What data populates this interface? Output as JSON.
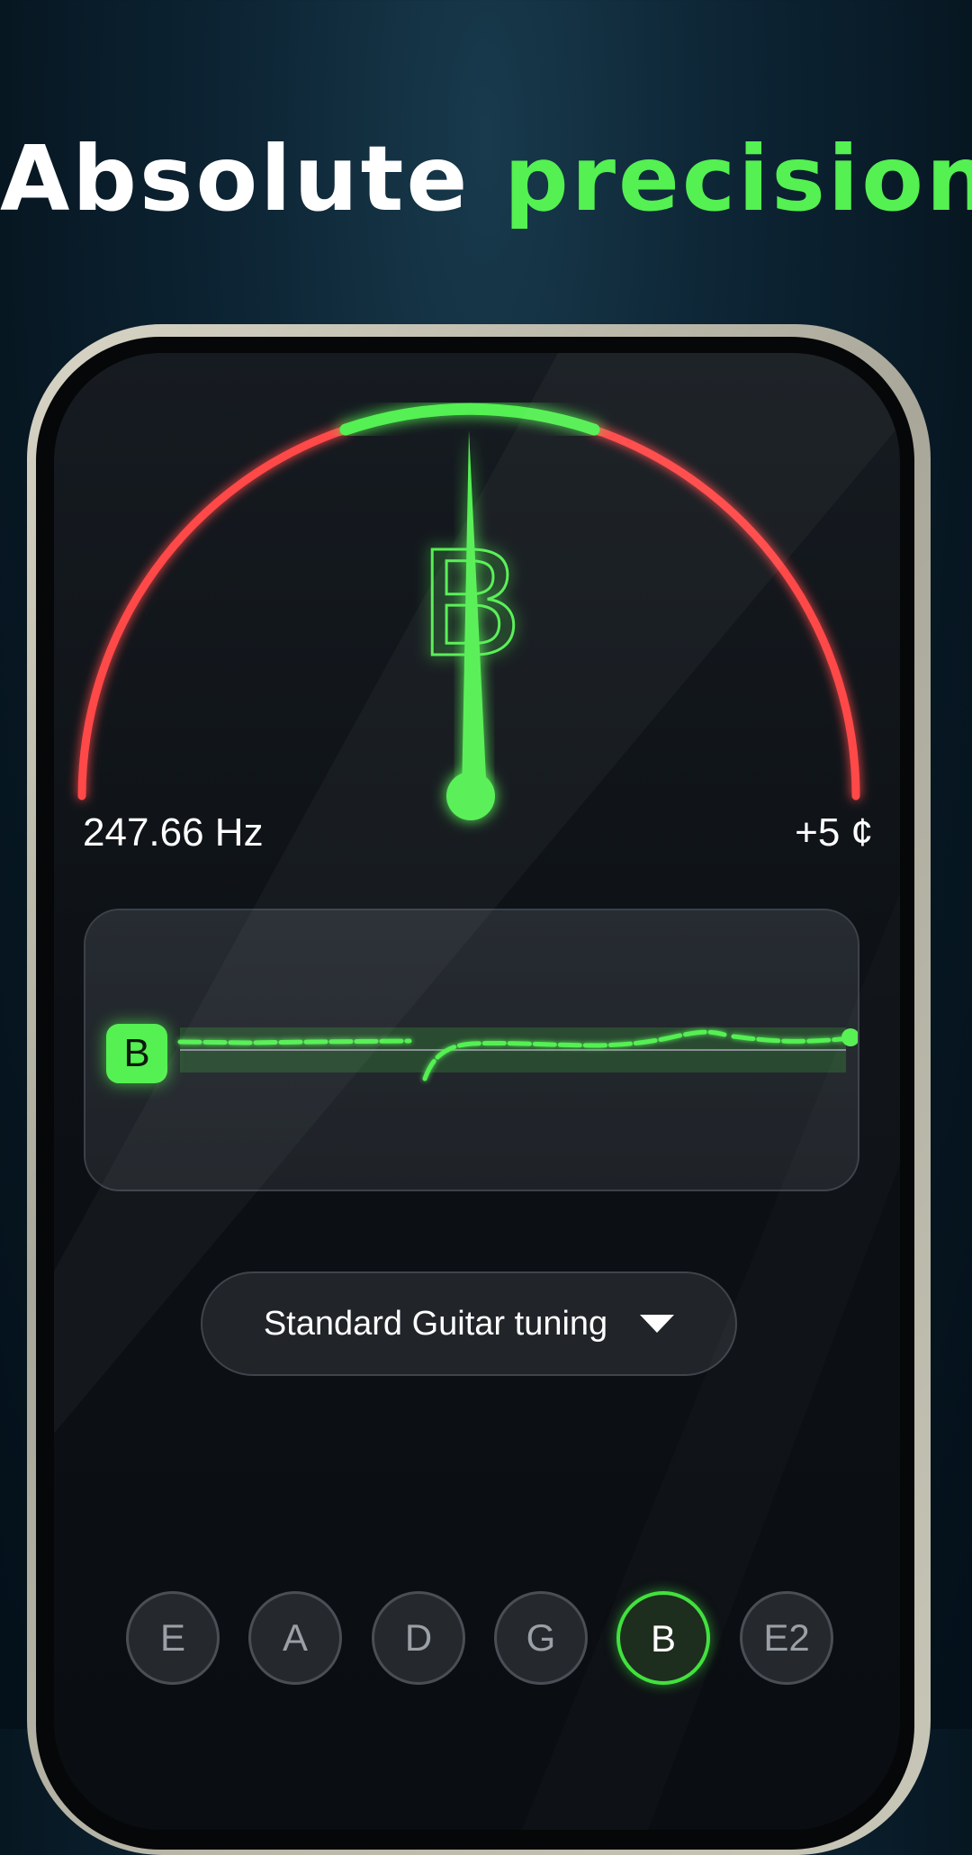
{
  "headline": {
    "part1": "Absolute",
    "part2": "precision"
  },
  "tuner": {
    "note": "B",
    "frequency": "247.66 Hz",
    "cents": "+5 ¢",
    "cents_value": 5
  },
  "history": {
    "note": "B"
  },
  "tuning": {
    "label": "Standard Guitar tuning"
  },
  "strings": [
    {
      "label": "E",
      "active": false
    },
    {
      "label": "A",
      "active": false
    },
    {
      "label": "D",
      "active": false
    },
    {
      "label": "G",
      "active": false
    },
    {
      "label": "B",
      "active": true
    },
    {
      "label": "E2",
      "active": false
    }
  ],
  "colors": {
    "accent": "#55f052",
    "warning": "#ff4a4a",
    "background": "#0d2535"
  },
  "icons": [
    "chevron-down-icon"
  ]
}
